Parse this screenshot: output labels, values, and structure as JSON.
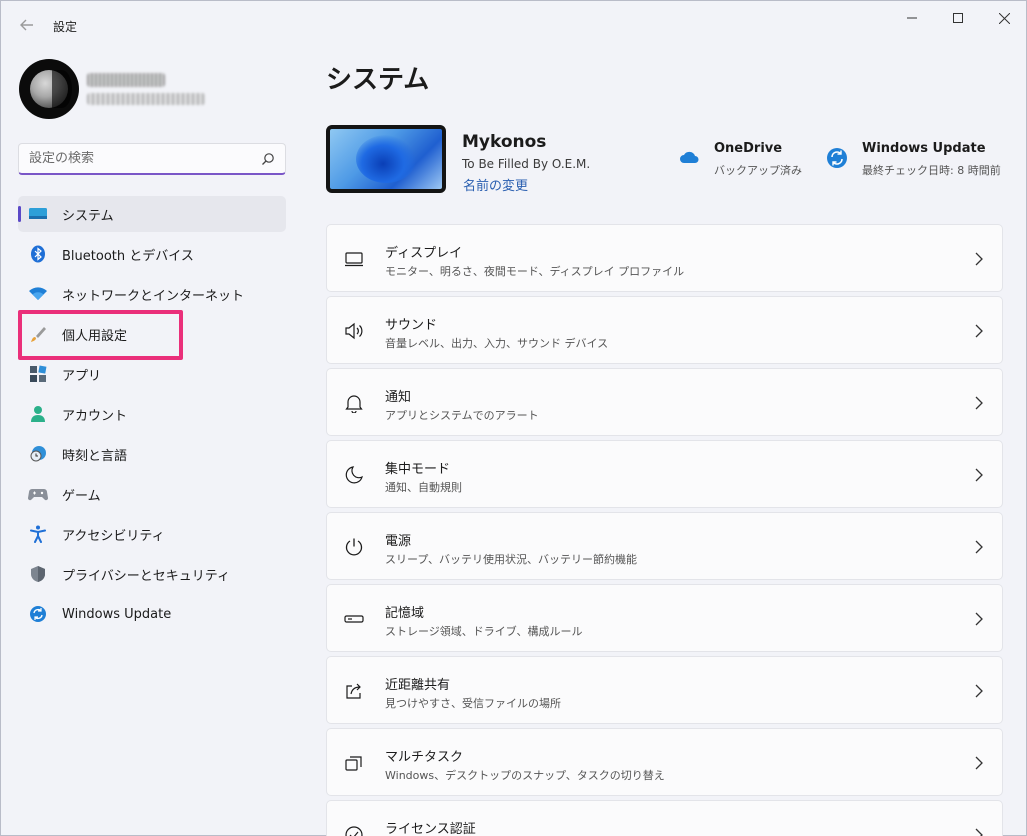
{
  "window": {
    "title": "設定"
  },
  "sidebar": {
    "search_placeholder": "設定の検索",
    "items": [
      {
        "label": "システム",
        "icon": "system-display-icon",
        "active": true
      },
      {
        "label": "Bluetooth とデバイス",
        "icon": "bluetooth-icon"
      },
      {
        "label": "ネットワークとインターネット",
        "icon": "wifi-icon"
      },
      {
        "label": "個人用設定",
        "icon": "brush-icon"
      },
      {
        "label": "アプリ",
        "icon": "apps-icon"
      },
      {
        "label": "アカウント",
        "icon": "account-icon"
      },
      {
        "label": "時刻と言語",
        "icon": "time-language-icon"
      },
      {
        "label": "ゲーム",
        "icon": "gamepad-icon"
      },
      {
        "label": "アクセシビリティ",
        "icon": "accessibility-icon"
      },
      {
        "label": "プライバシーとセキュリティ",
        "icon": "shield-icon"
      },
      {
        "label": "Windows Update",
        "icon": "windows-update-icon"
      }
    ]
  },
  "main": {
    "title": "システム",
    "device": {
      "name": "Mykonos",
      "model": "To Be Filled By O.E.M.",
      "rename": "名前の変更"
    },
    "quick": {
      "onedrive": {
        "title": "OneDrive",
        "sub": "バックアップ済み"
      },
      "update": {
        "title": "Windows Update",
        "sub": "最終チェック日時: 8 時間前"
      }
    },
    "cards": [
      {
        "title": "ディスプレイ",
        "sub": "モニター、明るさ、夜間モード、ディスプレイ プロファイル",
        "icon": "monitor-icon"
      },
      {
        "title": "サウンド",
        "sub": "音量レベル、出力、入力、サウンド デバイス",
        "icon": "speaker-icon"
      },
      {
        "title": "通知",
        "sub": "アプリとシステムでのアラート",
        "icon": "bell-icon"
      },
      {
        "title": "集中モード",
        "sub": "通知、自動規則",
        "icon": "moon-icon"
      },
      {
        "title": "電源",
        "sub": "スリープ、バッテリ使用状況、バッテリー節約機能",
        "icon": "power-icon"
      },
      {
        "title": "記憶域",
        "sub": "ストレージ領域、ドライブ、構成ルール",
        "icon": "storage-icon"
      },
      {
        "title": "近距離共有",
        "sub": "見つけやすさ、受信ファイルの場所",
        "icon": "share-icon"
      },
      {
        "title": "マルチタスク",
        "sub": "Windows、デスクトップのスナップ、タスクの切り替え",
        "icon": "multitask-icon"
      },
      {
        "title": "ライセンス認証",
        "sub": "",
        "icon": "activation-icon"
      }
    ]
  },
  "colors": {
    "accent": "#5b49c7",
    "highlight": "#ea2f7a",
    "link": "#2a5fb0"
  }
}
